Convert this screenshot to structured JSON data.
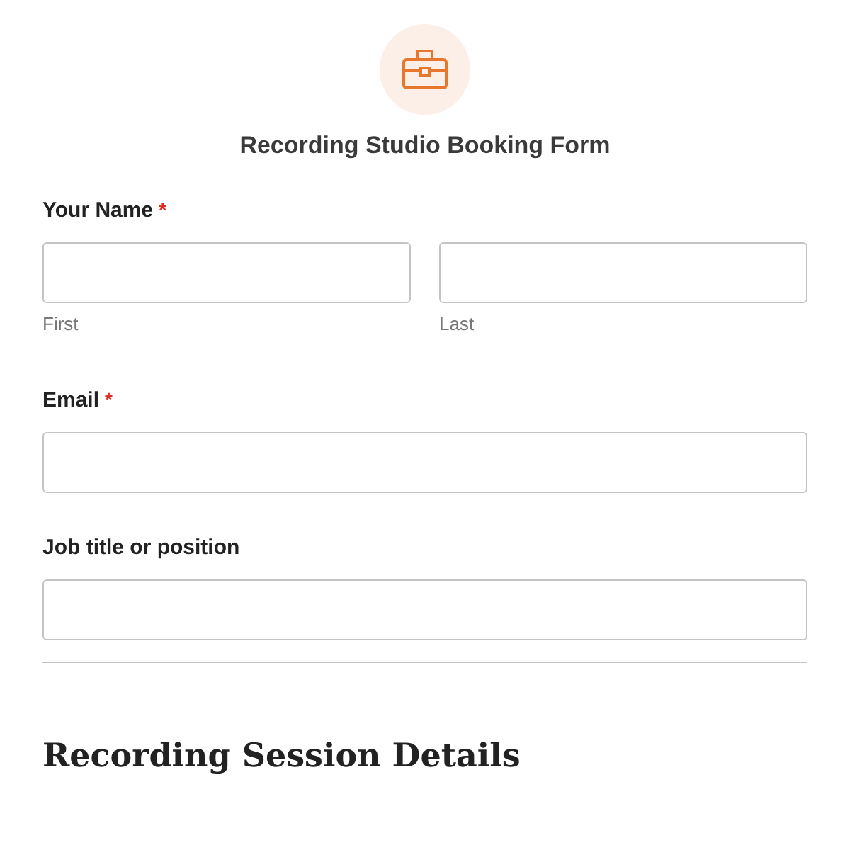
{
  "form": {
    "title": "Recording Studio Booking Form"
  },
  "fields": [
    {
      "kind": "name",
      "label": "Your Name",
      "required_mark": "*",
      "parts": [
        {
          "sublabel": "First"
        },
        {
          "sublabel": "Last"
        }
      ]
    },
    {
      "kind": "text",
      "label": "Email",
      "required_mark": "*"
    },
    {
      "kind": "text",
      "label": "Job title or position"
    }
  ],
  "section": {
    "heading": "Recording Session Details"
  }
}
